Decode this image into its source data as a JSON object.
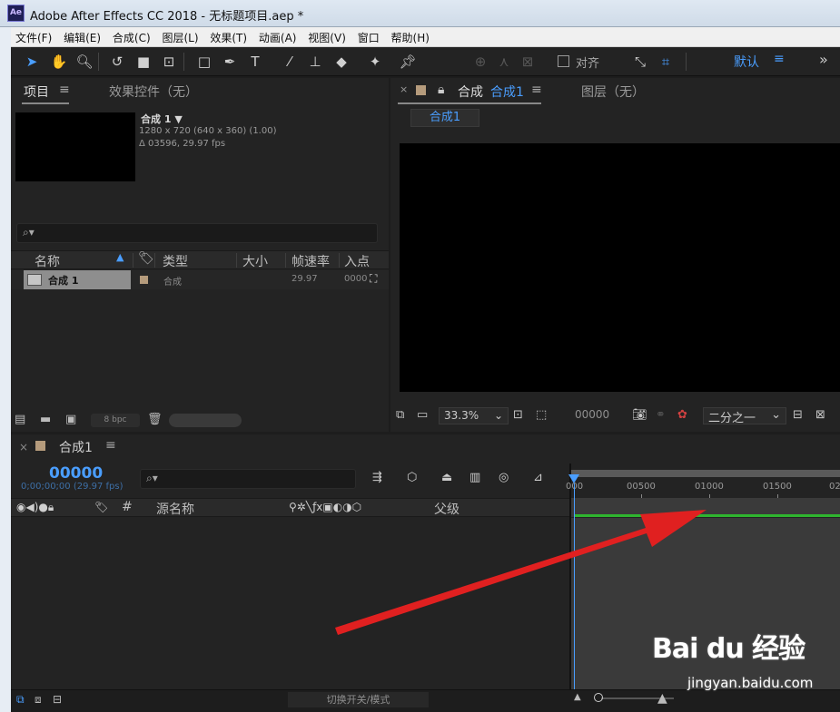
{
  "window": {
    "title": "Adobe After Effects CC 2018 - 无标题项目.aep *",
    "app_icon": "Ae"
  },
  "menu": [
    "文件(F)",
    "编辑(E)",
    "合成(C)",
    "图层(L)",
    "效果(T)",
    "动画(A)",
    "视图(V)",
    "窗口",
    "帮助(H)"
  ],
  "toolbar": {
    "tools": [
      "selection-tool",
      "hand-tool",
      "zoom-tool",
      "rotate-tool",
      "camera-tool",
      "pan-behind-tool",
      "rectangle-tool",
      "pen-tool",
      "type-tool",
      "brush-tool",
      "clone-stamp-tool",
      "eraser-tool",
      "roto-brush-tool",
      "puppet-pin-tool"
    ],
    "align_label": "对齐",
    "workspace_label": "默认",
    "menu_glyph": "≡",
    "more_glyph": "»"
  },
  "project": {
    "tab_label": "项目",
    "effects_tab_label": "效果控件（无）",
    "comp_name": "合成 1 ▼",
    "comp_resolution": "1280 x 720  (640 x 360) (1.00)",
    "comp_duration": "Δ 03596, 29.97 fps",
    "columns": [
      "名称",
      "类型",
      "大小",
      "帧速率",
      "入点"
    ],
    "row": {
      "name": "合成 1",
      "type": "合成",
      "fps": "29.97",
      "in": "0000"
    },
    "bpc": "8 bpc"
  },
  "composition": {
    "tab_label": "合成",
    "tab_name": "合成1",
    "layer_tab_label": "图层（无）",
    "subtab": "合成1",
    "zoom": "33.3%",
    "timecode": "00000",
    "resolution": "二分之一"
  },
  "timeline": {
    "tab_name": "合成1",
    "timecode": "00000",
    "subcode": "0;00;00;00 (29.97 fps)",
    "columns": [
      "#",
      "源名称",
      "父级"
    ],
    "ruler_labels": [
      "000",
      "00500",
      "01000",
      "01500",
      "02"
    ],
    "toggle_modes": "切换开关/模式"
  },
  "watermark": {
    "logo": "Bai du 经验",
    "url": "jingyan.baidu.com"
  },
  "colors": {
    "accent": "#4a9eff",
    "label_sandstone": "#b59b7c",
    "annotation_red": "#e02020",
    "work_area_green": "#2fb52f"
  }
}
